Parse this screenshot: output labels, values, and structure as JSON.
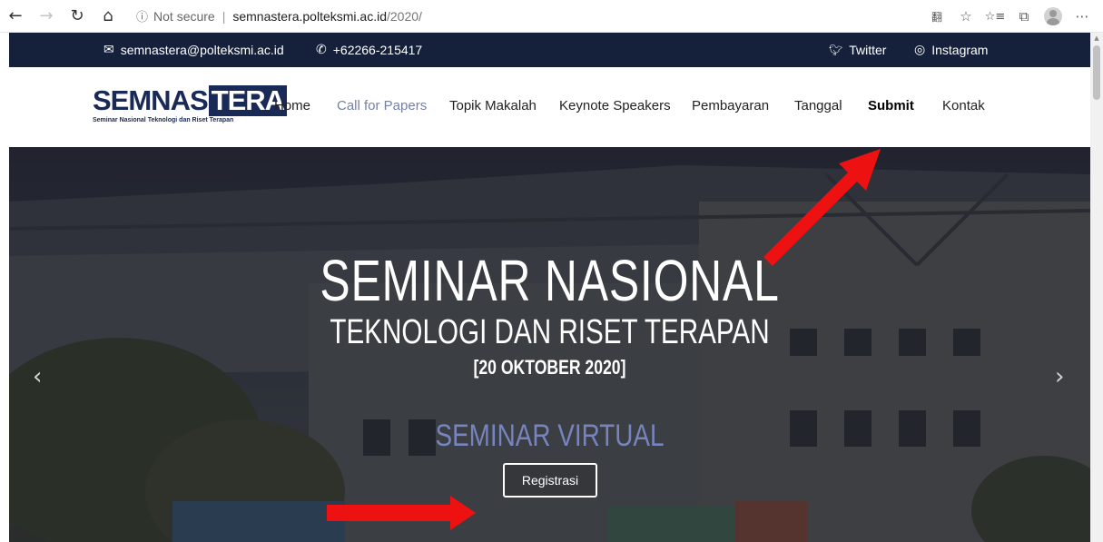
{
  "browser": {
    "back_icon": "←",
    "forward_icon": "→",
    "refresh_icon": "↻",
    "home_icon": "⌂",
    "info_icon": "ⓘ",
    "security_label": "Not secure",
    "url_host": "semnastera.polteksmi.ac.id",
    "url_path": "/2020/",
    "tools": {
      "translate_icon": "翻",
      "star_icon": "☆",
      "favorites_icon": "⭐",
      "collections_icon": "⧉",
      "more_icon": "⋯"
    }
  },
  "topbar": {
    "email_icon": "✉",
    "email": "semnastera@polteksmi.ac.id",
    "phone_icon": "✆",
    "phone": "+62266-215417",
    "twitter_icon": "🐦",
    "twitter_label": "Twitter",
    "instagram_icon": "◎",
    "instagram_label": "Instagram"
  },
  "logo": {
    "main_a": "SEMNAS",
    "main_b": "TERA",
    "subtitle": "Seminar Nasional Teknologi dan Riset Terapan"
  },
  "menu": {
    "items": [
      {
        "label": "Home"
      },
      {
        "label": "Call for Papers"
      },
      {
        "label": "Topik Makalah"
      },
      {
        "label": "Keynote Speakers"
      },
      {
        "label": "Pembayaran"
      },
      {
        "label": "Tanggal"
      },
      {
        "label": "Submit"
      },
      {
        "label": "Kontak"
      }
    ],
    "active_color": "#7480a8"
  },
  "hero": {
    "title": "SEMINAR NASIONAL",
    "subtitle": "TEKNOLOGI DAN RISET TERAPAN",
    "date": "[20 OKTOBER 2020]",
    "virtual": "SEMINAR VIRTUAL",
    "register_label": "Registrasi",
    "prev_icon": "‹",
    "next_icon": "›",
    "accent_color": "#7884bd"
  },
  "colors": {
    "topbar_bg": "#15213b",
    "annotation_arrow": "#ee1111"
  }
}
